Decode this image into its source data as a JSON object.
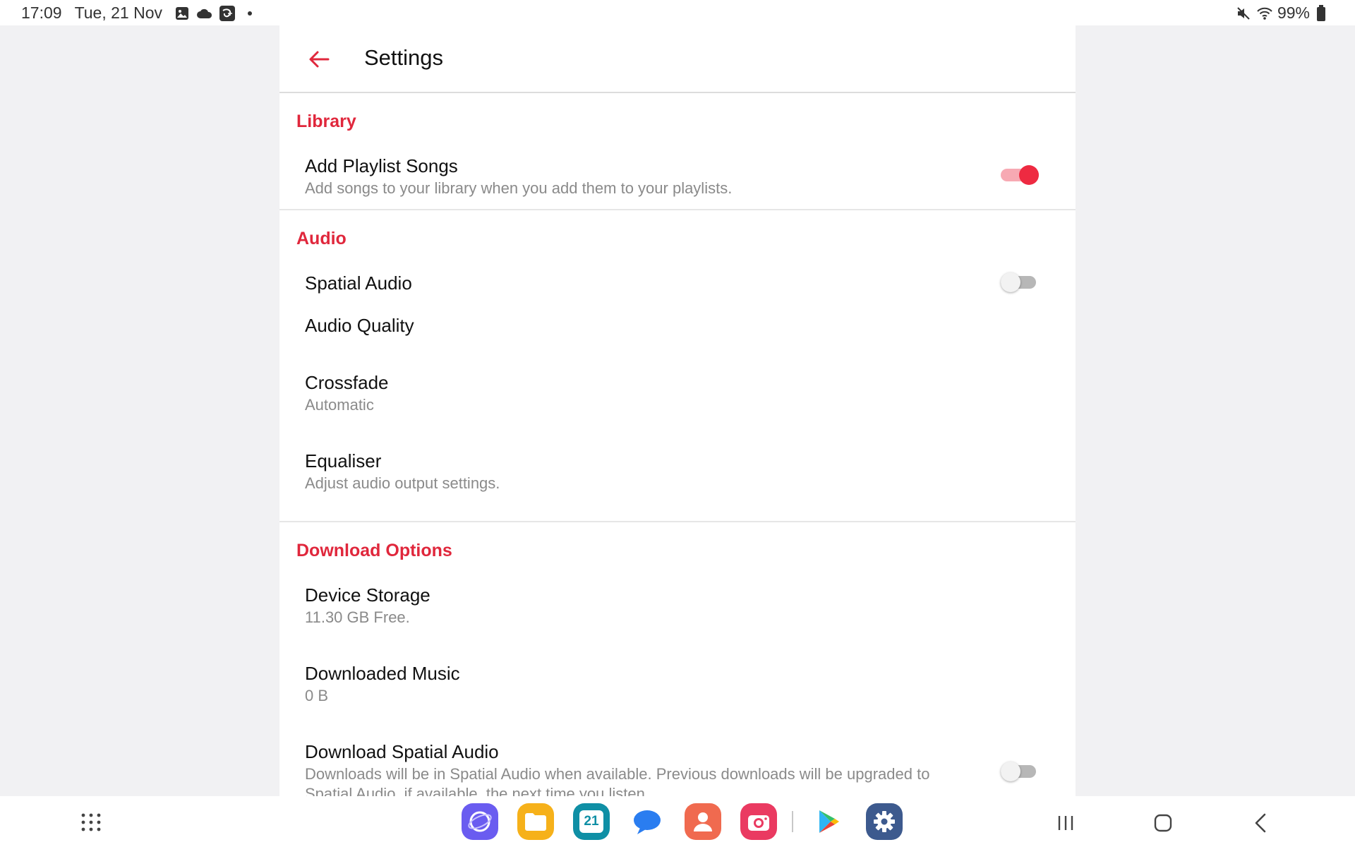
{
  "status_bar": {
    "time": "17:09",
    "date": "Tue, 21 Nov",
    "battery": "99%",
    "left_icons": [
      "gallery-icon",
      "cloud-icon",
      "disney-plus-icon",
      "dot-icon"
    ],
    "right_icons": [
      "mute-icon",
      "wifi-icon",
      "battery-icon"
    ]
  },
  "header": {
    "title": "Settings",
    "back_icon": "arrow-left-icon"
  },
  "sections": {
    "library": {
      "header": "Library",
      "add_playlist_songs": {
        "title": "Add Playlist Songs",
        "subtitle": "Add songs to your library when you add them to your playlists.",
        "toggle": "on"
      }
    },
    "audio": {
      "header": "Audio",
      "spatial_audio": {
        "title": "Spatial Audio",
        "toggle": "off"
      },
      "audio_quality": {
        "title": "Audio Quality"
      },
      "crossfade": {
        "title": "Crossfade",
        "subtitle": "Automatic"
      },
      "equaliser": {
        "title": "Equaliser",
        "subtitle": "Adjust audio output settings."
      }
    },
    "download_options": {
      "header": "Download Options",
      "device_storage": {
        "title": "Device Storage",
        "subtitle": "11.30 GB Free."
      },
      "downloaded_music": {
        "title": "Downloaded Music",
        "subtitle": "0 B"
      },
      "download_spatial_audio": {
        "title": "Download Spatial Audio",
        "subtitle": "Downloads will be in Spatial Audio when available. Previous downloads will be upgraded to Spatial Audio, if available, the next time you listen.",
        "toggle": "off"
      }
    }
  },
  "nav_bar": {
    "apps": [
      {
        "icon": "internet-browser-icon",
        "color": "#6a5cf0"
      },
      {
        "icon": "my-files-icon",
        "color": "#f6b11a"
      },
      {
        "icon": "calendar-icon",
        "color": "#0f8fa5",
        "label": "21"
      },
      {
        "icon": "messages-icon",
        "color": "#2a7df0"
      },
      {
        "icon": "contacts-icon",
        "color": "#f06a4f"
      },
      {
        "icon": "camera-icon",
        "color": "#ea3a61"
      },
      {
        "icon": "play-store-icon",
        "color": "#ffffff"
      },
      {
        "icon": "settings-icon",
        "color": "#3d5a8e"
      }
    ],
    "buttons": [
      "recents-icon",
      "home-icon",
      "back-icon"
    ]
  },
  "colors": {
    "accent": "#e0273c",
    "toggle_on": "#ee2a41",
    "background": "#f1f1f3"
  }
}
